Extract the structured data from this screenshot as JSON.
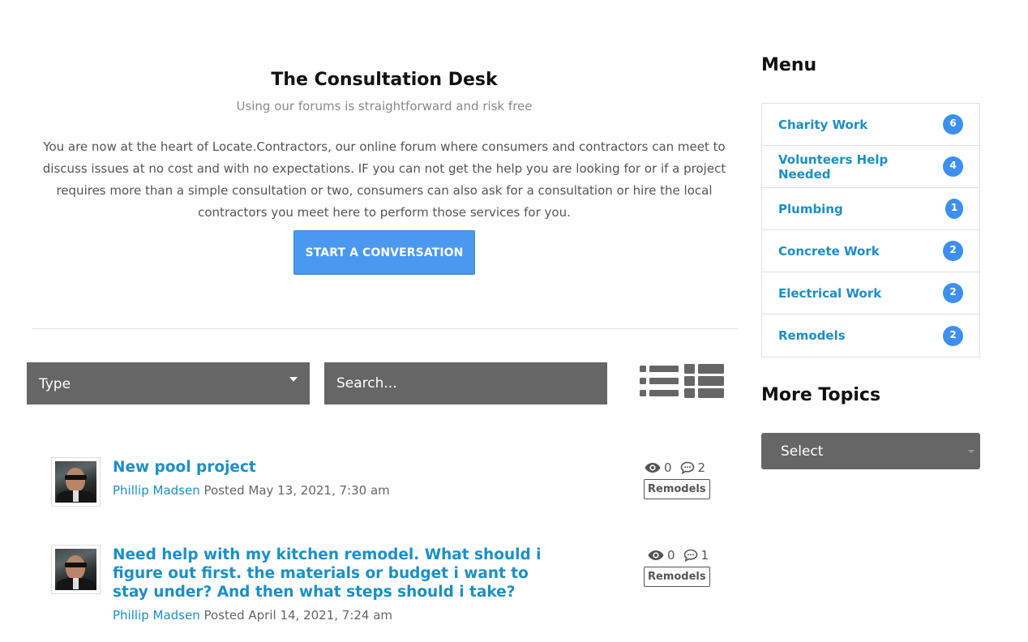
{
  "header": {
    "title": "The Consultation Desk",
    "subtitle": "Using our forums is straightforward and risk free",
    "intro": "You are now at the heart of Locate.Contractors, our online forum where consumers and contractors can meet to discuss issues at no cost and with no expectations. IF you can not get the help you are looking for or if a project requires more than a simple consultation or two, consumers can also ask for a consultation or hire the local contractors you meet here to perform those services for you.",
    "start_button": "START A CONVERSATION"
  },
  "filters": {
    "type_label": "Type",
    "search_placeholder": "Search..."
  },
  "topics": [
    {
      "title": "New pool project",
      "author": "Phillip Madsen",
      "posted": "Posted May 13, 2021, 7:30 am",
      "views": "0",
      "replies": "2",
      "tag": "Remodels"
    },
    {
      "title": "Need help with my kitchen remodel. What should i figure out first. the materials or budget i want to stay under? And then what steps should i take?",
      "author": "Phillip Madsen",
      "posted": "Posted April 14, 2021, 7:24 am",
      "views": "0",
      "replies": "1",
      "tag": "Remodels"
    }
  ],
  "sidebar": {
    "menu_heading": "Menu",
    "menu": [
      {
        "label": "Charity Work",
        "count": "6"
      },
      {
        "label": "Volunteers Help Needed",
        "count": "4"
      },
      {
        "label": "Plumbing",
        "count": "1"
      },
      {
        "label": "Concrete Work",
        "count": "2"
      },
      {
        "label": "Electrical Work",
        "count": "2"
      },
      {
        "label": "Remodels",
        "count": "2"
      }
    ],
    "more_heading": "More Topics",
    "more_select": "Select"
  },
  "colors": {
    "link": "#1c8fc7",
    "button": "#4a98f0",
    "badge": "#3d8ff0",
    "control_bg": "#666666"
  },
  "icons": [
    "list-view-icon",
    "grid-view-icon",
    "eye-icon",
    "comment-icon",
    "caret-down-icon"
  ]
}
